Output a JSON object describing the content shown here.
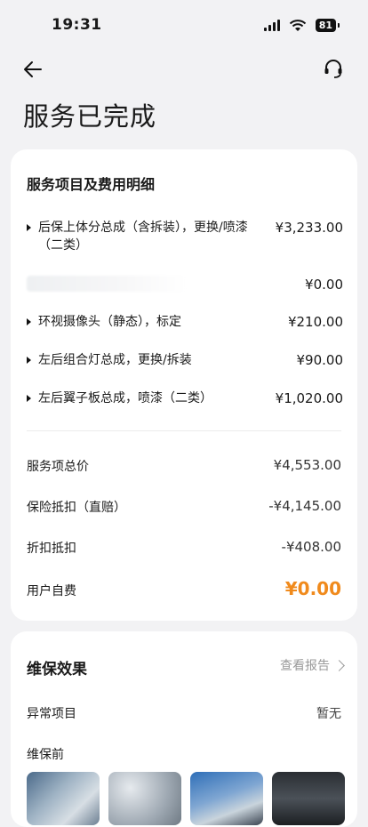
{
  "status_bar": {
    "time": "19:31",
    "battery": "81"
  },
  "page": {
    "title": "服务已完成"
  },
  "fees": {
    "title": "服务项目及费用明细",
    "items": [
      {
        "name": "后保上体分总成（含拆装），更换/喷漆（二类）",
        "price": "¥3,233.00"
      },
      {
        "name": "",
        "price": "¥0.00"
      },
      {
        "name": "环视摄像头（静态），标定",
        "price": "¥210.00"
      },
      {
        "name": "左后组合灯总成，更换/拆装",
        "price": "¥90.00"
      },
      {
        "name": "左后翼子板总成，喷漆（二类）",
        "price": "¥1,020.00"
      }
    ],
    "summary": [
      {
        "label": "服务项总价",
        "value": "¥4,553.00"
      },
      {
        "label": "保险抵扣（直赔）",
        "value": "-¥4,145.00"
      },
      {
        "label": "折扣抵扣",
        "value": "-¥408.00"
      },
      {
        "label": "用户自费",
        "value": "¥0.00"
      }
    ],
    "accent_color": "#f08a1c"
  },
  "effect": {
    "title": "维保效果",
    "report_link": "查看报告",
    "abnormal_label": "异常项目",
    "abnormal_value": "暂无",
    "before_label": "维保前"
  }
}
